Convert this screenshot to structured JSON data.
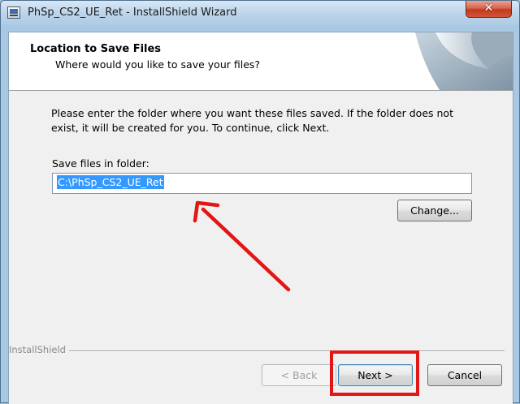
{
  "window": {
    "title": "PhSp_CS2_UE_Ret - InstallShield Wizard",
    "close_glyph": "✕"
  },
  "header": {
    "title": "Location to Save Files",
    "subtitle": "Where would you like to save your files?"
  },
  "body": {
    "instructions": "Please enter the folder where you want these files saved.  If the folder does not exist, it will be created for you.   To continue, click Next.",
    "folder_label": "Save files in folder:",
    "folder_value": "C:\\PhSp_CS2_UE_Ret",
    "change_label": "Change..."
  },
  "footer": {
    "brand": "InstallShield",
    "back_label": "< Back",
    "next_label": "Next >",
    "cancel_label": "Cancel"
  },
  "icons": {
    "app": "installer-icon",
    "close": "close-icon",
    "header_art": "page-curl-icon"
  },
  "annotations": {
    "highlight_color": "#e31616",
    "arrow_color": "#e31616"
  }
}
